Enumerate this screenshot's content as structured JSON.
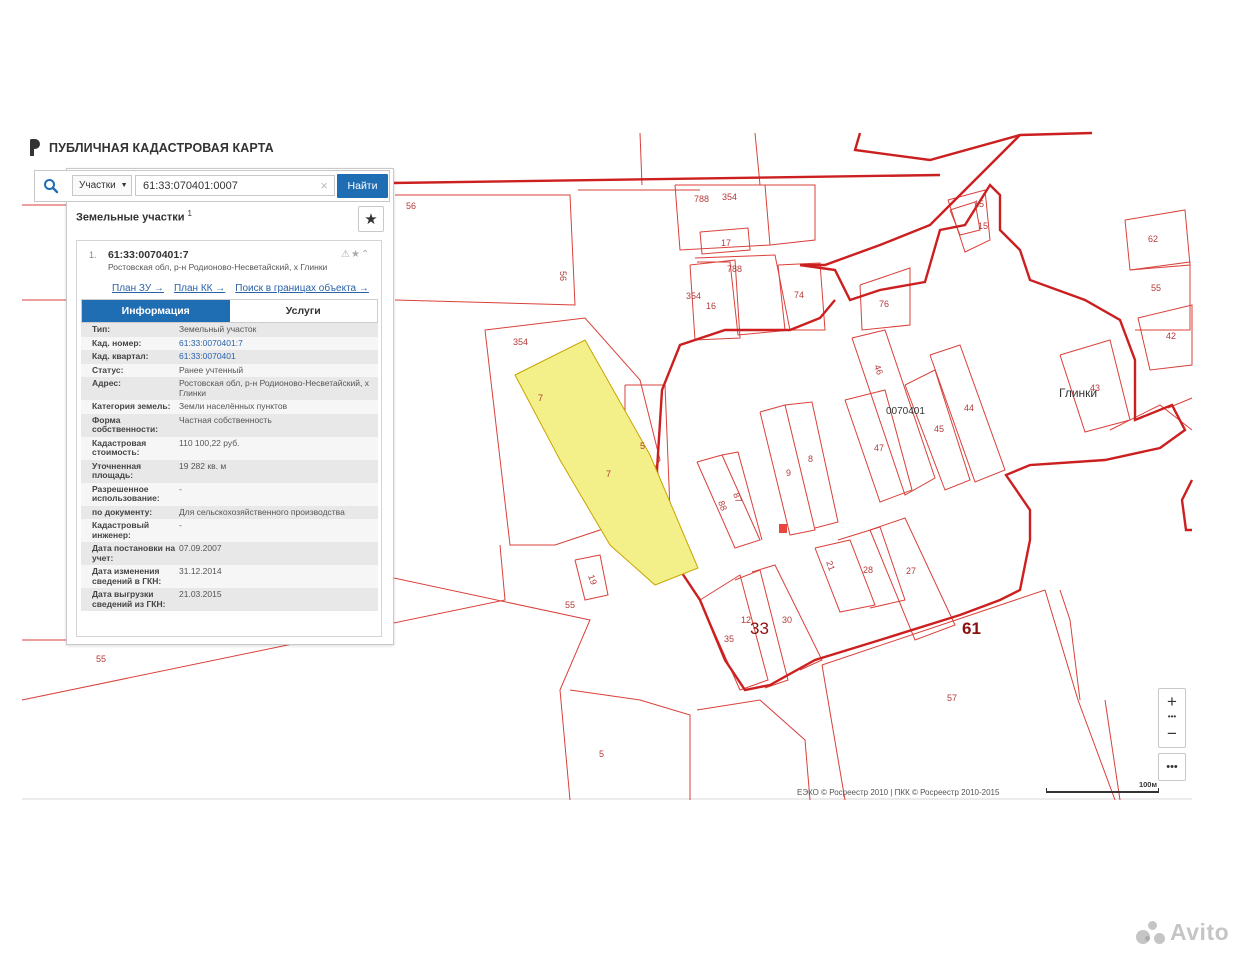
{
  "header": {
    "title": "ПУБЛИЧНАЯ КАДАСТРОВАЯ КАРТА"
  },
  "search": {
    "type_select": "Участки",
    "query": "61:33:070401:0007",
    "find_label": "Найти"
  },
  "results": {
    "section_title": "Земельные участки",
    "count": "1",
    "card": {
      "index": "1.",
      "title": "61:33:0070401:7",
      "address": "Ростовская обл, р-н Родионово-Несветайский, х Глинки",
      "links": [
        "План ЗУ →",
        "План КК →",
        "Поиск в границах объекта →"
      ],
      "tabs": [
        "Информация",
        "Услуги"
      ],
      "rows": [
        {
          "key": "Тип:",
          "value": "Земельный участок"
        },
        {
          "key": "Кад. номер:",
          "value": "61:33:0070401:7"
        },
        {
          "key": "Кад. квартал:",
          "value": "61:33:0070401"
        },
        {
          "key": "Статус:",
          "value": "Ранее учтенный"
        },
        {
          "key": "Адрес:",
          "value": "Ростовская обл, р-н Родионово-Несветайский, х Глинки"
        },
        {
          "key": "Категория земель:",
          "value": "Земли населённых пунктов"
        },
        {
          "key": "Форма собственности:",
          "value": "Частная собственность"
        },
        {
          "key": "Кадастровая стоимость:",
          "value": "110 100,22 руб."
        },
        {
          "key": "Уточненная площадь:",
          "value": "19 282 кв. м"
        },
        {
          "key": "Разрешенное использование:",
          "value": "-"
        },
        {
          "key": "по документу:",
          "value": "Для сельскохозяйственного производства"
        },
        {
          "key": "Кадастровый инженер:",
          "value": "-"
        },
        {
          "key": "Дата постановки на учет:",
          "value": "07.09.2007"
        },
        {
          "key": "Дата изменения сведений в ГКН:",
          "value": "31.12.2014"
        },
        {
          "key": "Дата выгрузки сведений из ГКН:",
          "value": "21.03.2015"
        }
      ]
    }
  },
  "map": {
    "place_name": "Глинки",
    "block_number": "0070401",
    "district_numbers": [
      "33",
      "61"
    ],
    "plot_numbers": [
      "56",
      "56",
      "788",
      "354",
      "17",
      "788",
      "354",
      "16",
      "74",
      "76",
      "15",
      "15",
      "62",
      "55",
      "42",
      "43",
      "354",
      "7",
      "7",
      "5",
      "46",
      "0070401",
      "45",
      "44",
      "47",
      "9",
      "8",
      "88",
      "87",
      "19",
      "55",
      "21",
      "28",
      "27",
      "12",
      "35",
      "30",
      "57",
      "55",
      "5"
    ],
    "attribution": "ЕЭКО © Росреестр 2010 | ПКК © Росреестр 2010-2015",
    "scale_label": "100м",
    "colors": {
      "parcel": "#d9403a",
      "boundary": "#cc1f1f",
      "selected": "#f3f08a",
      "accent": "#1f6eb4"
    }
  },
  "controls": {
    "zoom_in": "+",
    "zoom_out": "−",
    "more": "•••"
  },
  "watermark": "Avito"
}
